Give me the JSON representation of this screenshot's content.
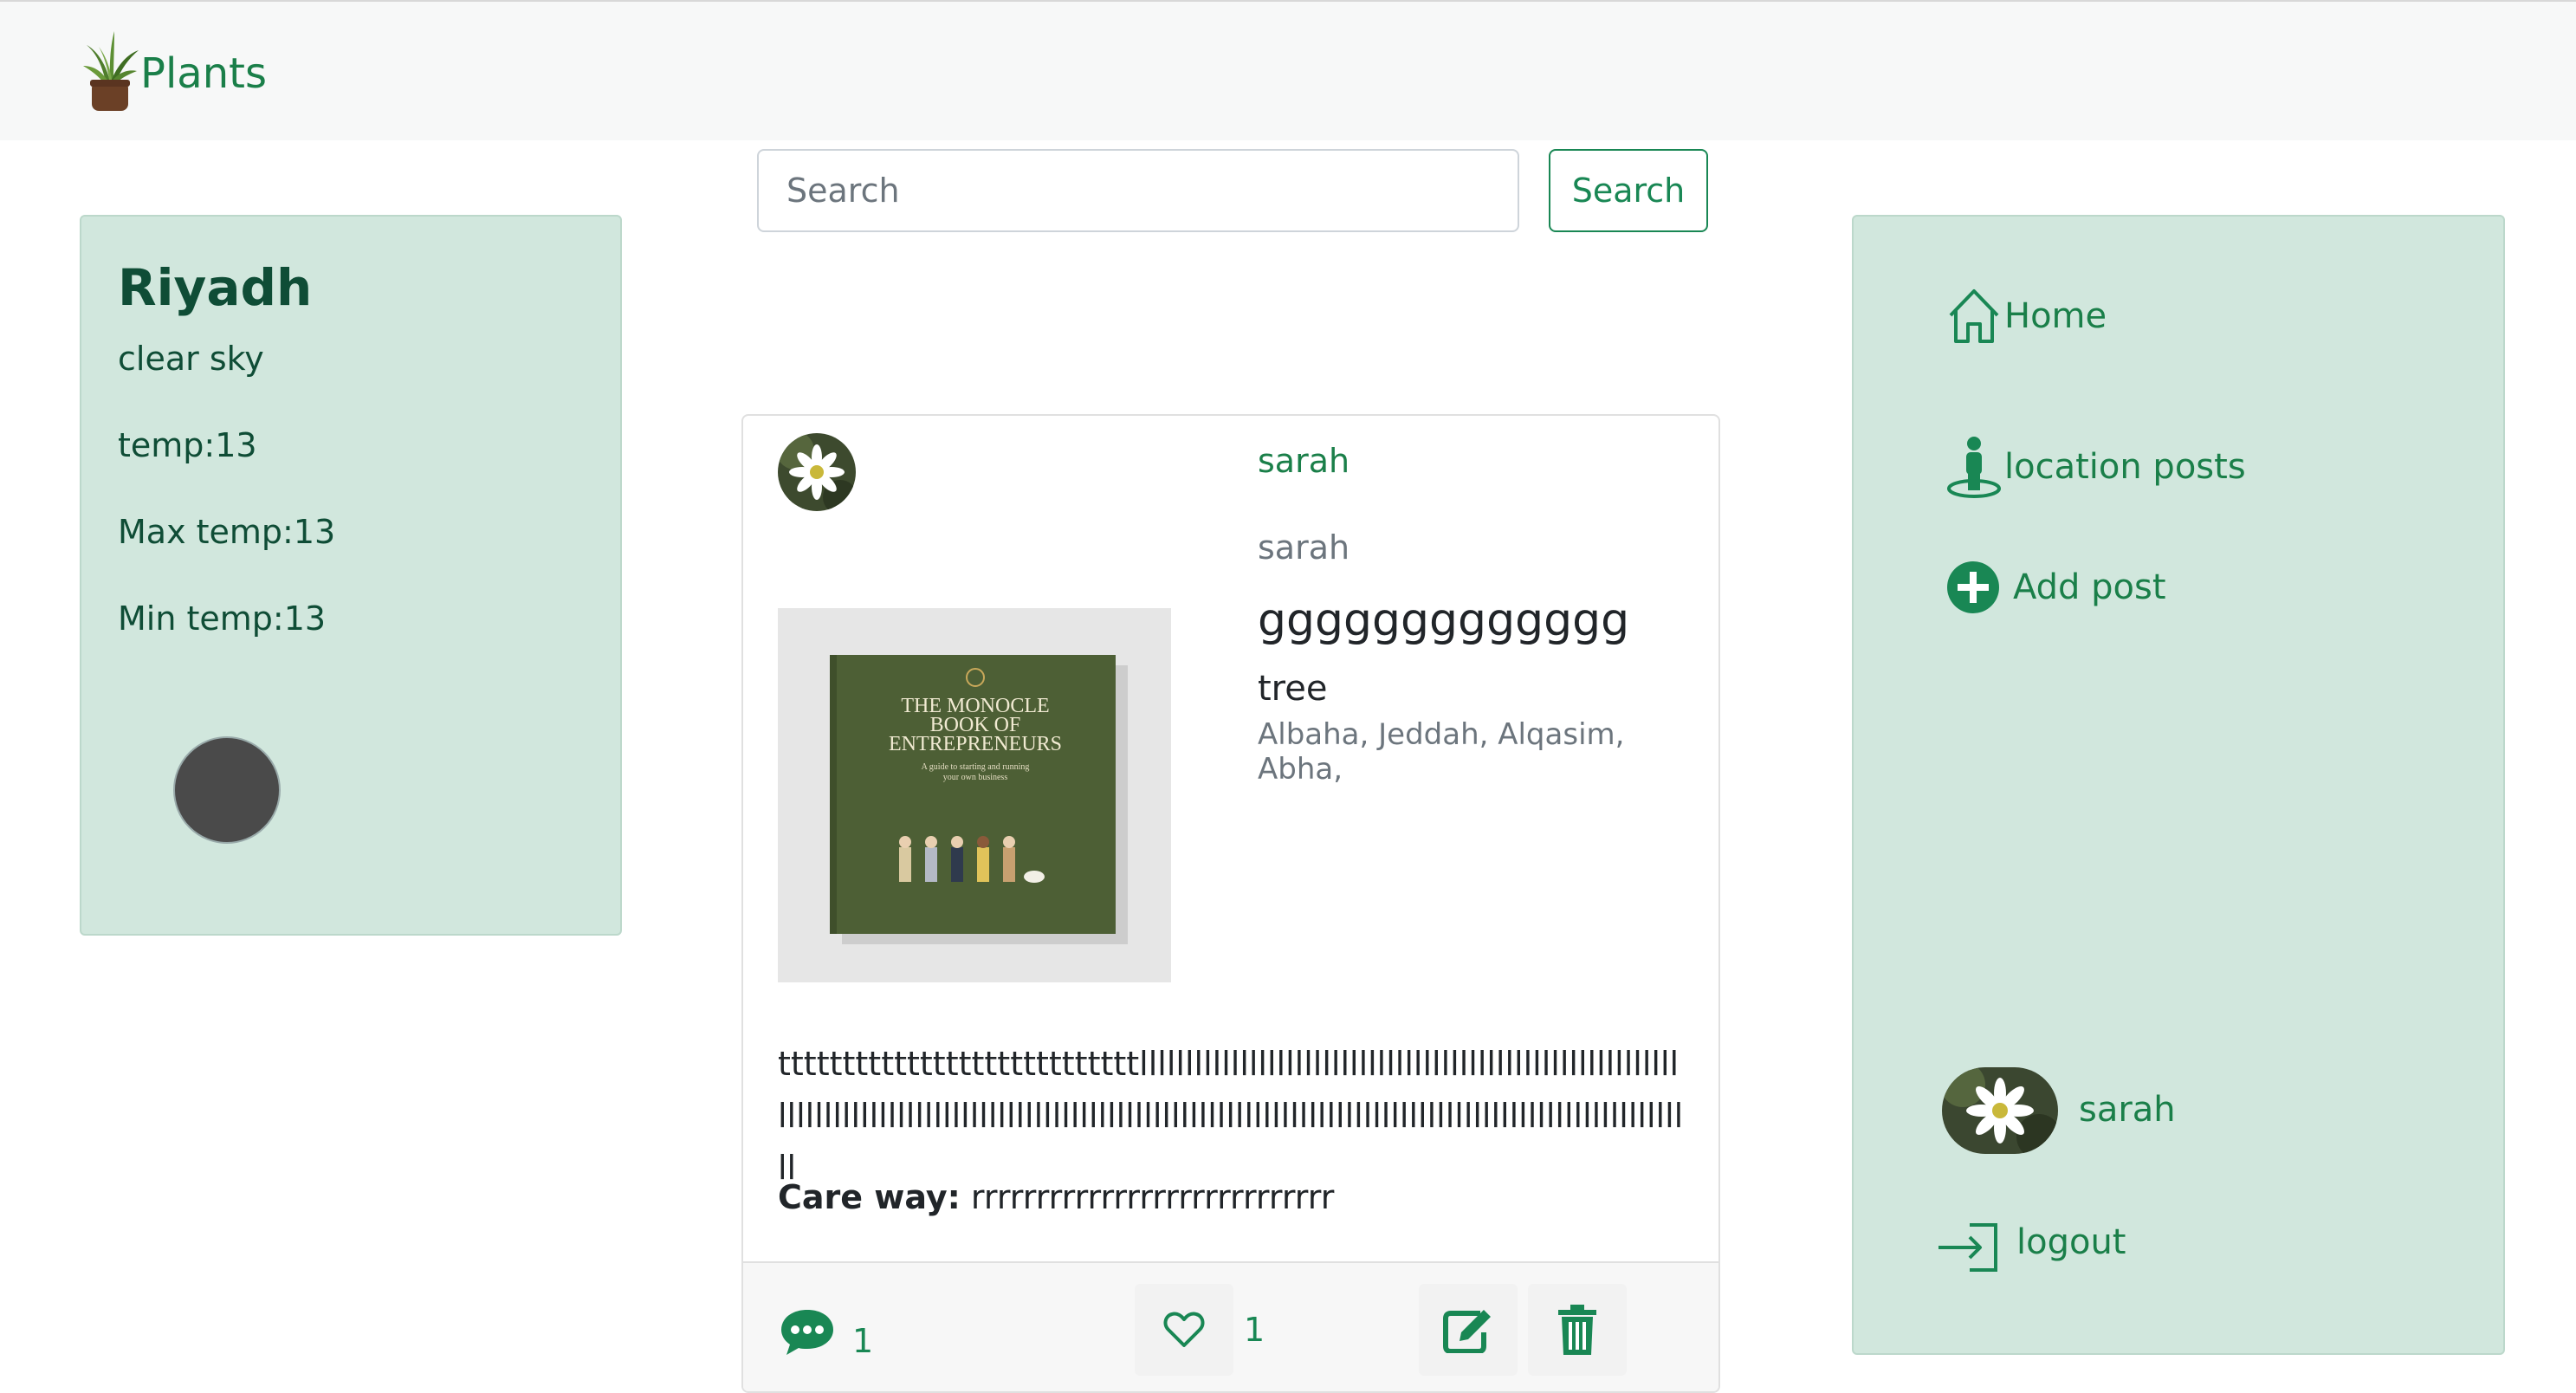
{
  "brand": {
    "name": "Plants",
    "logo_icon": "potted-plant-icon"
  },
  "weather": {
    "city": "Riyadh",
    "description": "clear sky",
    "temp": "temp:13",
    "max_temp": "Max temp:13",
    "min_temp": "Min temp:13"
  },
  "search": {
    "placeholder": "Search",
    "button_label": "Search"
  },
  "post": {
    "author_link": "sarah",
    "author_name": "sarah",
    "title": "ggggggggggggg",
    "type": "tree",
    "locations": "Albaha, Jeddah, Alqasim, Abha,",
    "description": "ttttttttttttttttttttttttttttllllllllllllllllllllllllllllllllllllllllllllllllllllllllllllllllllllllllllllllllllllllllllllllllllllllllllllllllllllllllllllllllllllllllllllllllllllllllllllllll",
    "care_label": "Care way:",
    "care_value": "rrrrrrrrrrrrrrrrrrrrrrrrrrrr",
    "book_title": "THE MONOCLE BOOK OF ENTREPRENEURS",
    "book_subtitle": "A guide to starting and running your own business",
    "comment_count": "1",
    "like_count": "1"
  },
  "sidebar": {
    "home_label": "Home",
    "location_posts_label": "location posts",
    "add_post_label": "Add post",
    "profile_name": "sarah",
    "logout_label": "logout"
  },
  "colors": {
    "accent": "#198754",
    "panel": "#d1e7dd",
    "text_dark": "#0f4d36"
  }
}
